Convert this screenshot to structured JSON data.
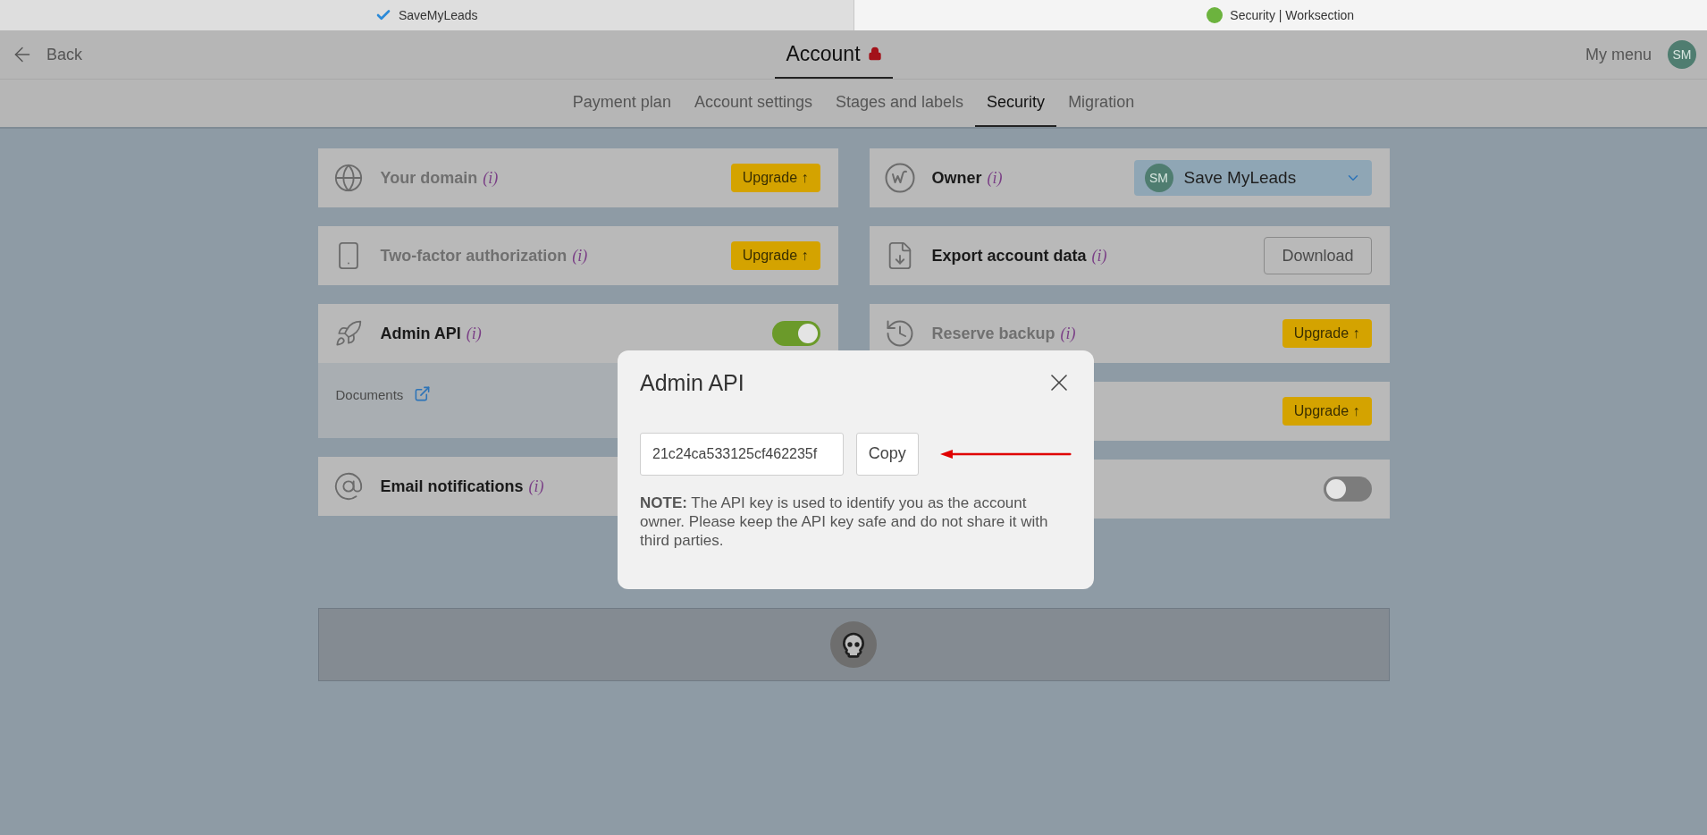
{
  "browser_tabs": [
    {
      "title": "SaveMyLeads",
      "selected": false
    },
    {
      "title": "Security | Worksection",
      "selected": true
    }
  ],
  "header": {
    "back_label": "Back",
    "title": "Account",
    "menu_label": "My menu",
    "avatar_initials": "SM"
  },
  "nav_tabs": [
    {
      "label": "Payment plan",
      "selected": false
    },
    {
      "label": "Account settings",
      "selected": false
    },
    {
      "label": "Stages and labels",
      "selected": false
    },
    {
      "label": "Security",
      "selected": true
    },
    {
      "label": "Migration",
      "selected": false
    }
  ],
  "left_cards": [
    {
      "kind": "upgrade",
      "label": "Your domain",
      "info": "(i)",
      "disabled": true,
      "action": "Upgrade ↑"
    },
    {
      "kind": "upgrade",
      "label": "Two-factor authorization",
      "info": "(i)",
      "disabled": true,
      "action": "Upgrade ↑"
    },
    {
      "kind": "toggle",
      "label": "Admin API",
      "info": "(i)",
      "disabled": false,
      "on": true,
      "details_link": "Documents"
    },
    {
      "kind": "plain",
      "label": "Email notifications",
      "info": "(i)",
      "disabled": false
    }
  ],
  "right_cards": [
    {
      "kind": "select",
      "label": "Owner",
      "info": "(i)",
      "disabled": false,
      "initials": "SM",
      "value": "Save MyLeads"
    },
    {
      "kind": "button",
      "label": "Export account data",
      "info": "(i)",
      "disabled": false,
      "action": "Download"
    },
    {
      "kind": "upgrade",
      "label": "Reserve backup",
      "info": "(i)",
      "disabled": true,
      "action": "Upgrade ↑"
    },
    {
      "kind": "upgrade",
      "action": "Upgrade ↑"
    },
    {
      "kind": "toggle",
      "on": false
    }
  ],
  "modal": {
    "title": "Admin API",
    "api_key": "21c24ca533125cf462235f",
    "copy_label": "Copy",
    "note": "**NOTE:** The API key is used to identify you as the account owner. Please keep the API key safe and do not share it with third parties."
  }
}
